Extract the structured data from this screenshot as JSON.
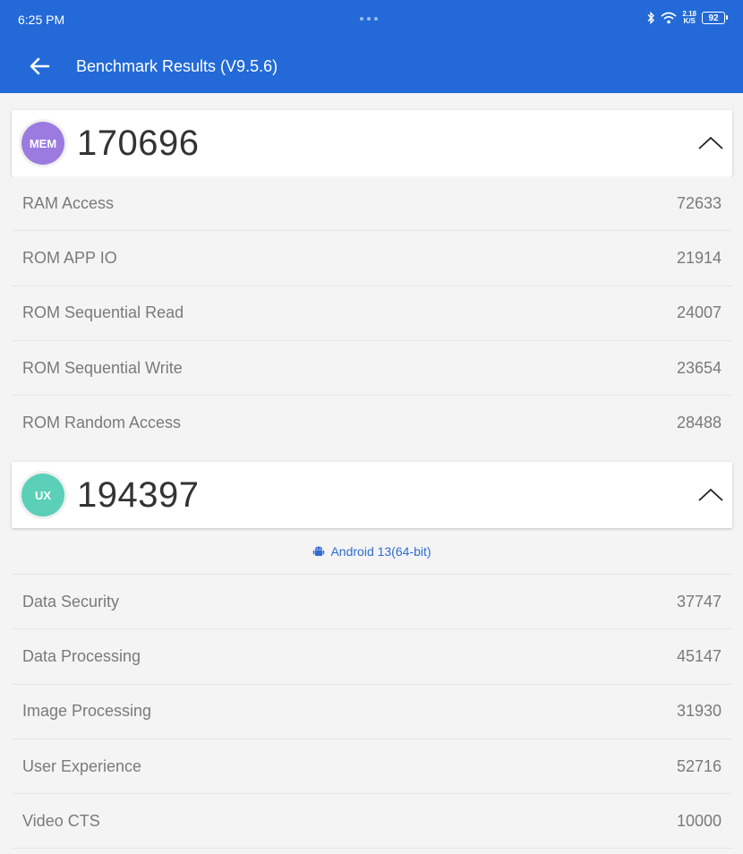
{
  "status_bar": {
    "time": "6:25 PM",
    "net_speed_value": "2.18",
    "net_speed_unit": "K/S",
    "battery": "92",
    "icons": [
      "bluetooth-icon",
      "wifi-icon",
      "battery-icon"
    ]
  },
  "toolbar": {
    "title": "Benchmark Results (V9.5.6)",
    "back_icon": "arrow-left-icon"
  },
  "mem": {
    "badge": "MEM",
    "badge_color": "#9b7be0",
    "score": "170696",
    "rows": [
      {
        "label": "RAM Access",
        "value": "72633"
      },
      {
        "label": "ROM APP IO",
        "value": "21914"
      },
      {
        "label": "ROM Sequential Read",
        "value": "24007"
      },
      {
        "label": "ROM Sequential Write",
        "value": "23654"
      },
      {
        "label": "ROM Random Access",
        "value": "28488"
      }
    ]
  },
  "ux": {
    "badge": "UX",
    "badge_color": "#5bcfb8",
    "score": "194397",
    "platform": "Android 13(64-bit)",
    "platform_icon": "android-icon",
    "rows": [
      {
        "label": "Data Security",
        "value": "37747"
      },
      {
        "label": "Data Processing",
        "value": "45147"
      },
      {
        "label": "Image Processing",
        "value": "31930"
      },
      {
        "label": "User Experience",
        "value": "52716"
      },
      {
        "label": "Video CTS",
        "value": "10000"
      }
    ]
  },
  "colors": {
    "primary": "#236ad8",
    "link": "#2f6bd1"
  }
}
